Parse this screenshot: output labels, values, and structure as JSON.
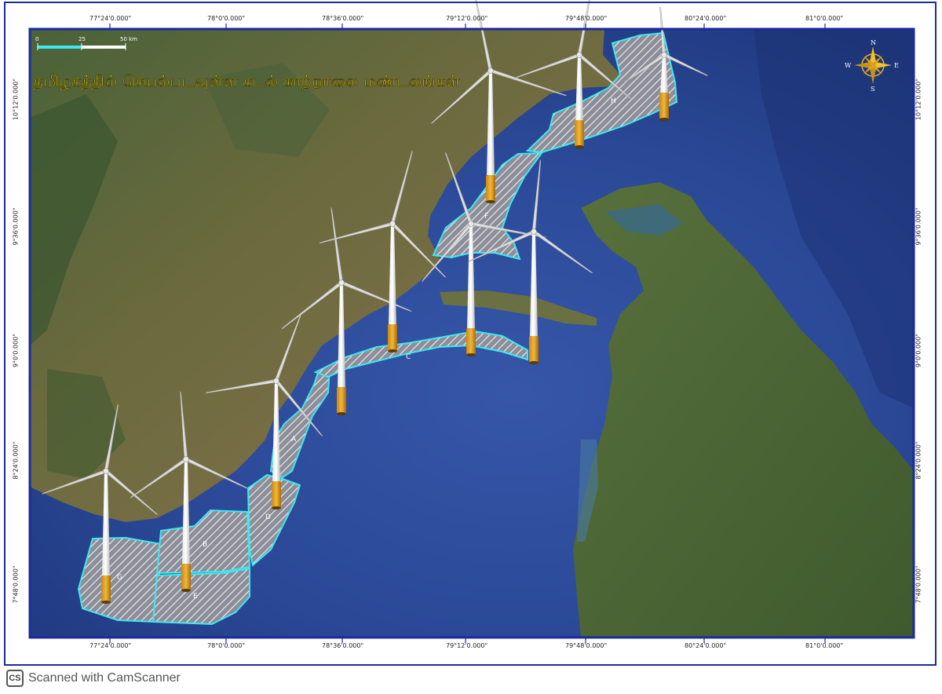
{
  "map": {
    "title": "தமிழகத்தில் செயல்படவுள்ள கடல் காற்றாலை மண்டலங்கள்",
    "top_labels": [
      "77°24'0.000\"",
      "78°0'0.000\"",
      "78°36'0.000\"",
      "79°12'0.000\"",
      "79°48'0.000\"",
      "80°24'0.000\"",
      "81°0'0.000\""
    ],
    "bottom_labels": [
      "77°24'0.000\"",
      "78°0'0.000\"",
      "78°36'0.000\"",
      "79°12'0.000\"",
      "79°48'0.000\"",
      "80°24'0.000\"",
      "81°0'0.000\""
    ],
    "left_labels": [
      "10°12'0.000\"",
      "9°36'0.000\"",
      "9°0'0.000\"",
      "8°24'0.000\"",
      "7°48'0.000\""
    ],
    "right_labels": [
      "10°12'0.000\"",
      "9°36'0.000\"",
      "9°0'0.000\"",
      "8°24'0.000\"",
      "7°48'0.000\""
    ],
    "scale_bar": {
      "labels": [
        "0",
        "25",
        "50 km"
      ]
    },
    "compass": {
      "n": "N",
      "s": "S",
      "e": "E",
      "w": "W"
    },
    "zones": [
      "A",
      "B",
      "C",
      "D",
      "E",
      "F",
      "G",
      "H"
    ],
    "colors": {
      "sea": "#2a4a9a",
      "land": "#4f6a3a",
      "zone_outline": "#3ee8f0",
      "title": "#f5e21a",
      "frame": "#1b2a9c"
    }
  },
  "footer": {
    "badge": "CS",
    "text": "Scanned with CamScanner"
  }
}
